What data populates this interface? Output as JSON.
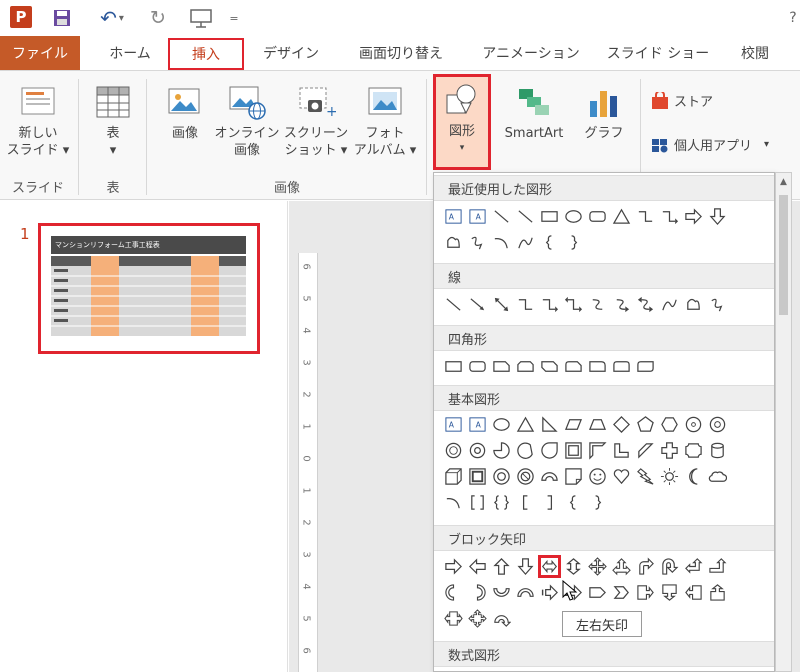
{
  "qat": {
    "app_logo": "P"
  },
  "tabs": [
    "ファイル",
    "ホーム",
    "挿入",
    "デザイン",
    "画面切り替え",
    "アニメーション",
    "スライド ショー",
    "校閲"
  ],
  "ribbon": {
    "new_slide": [
      "新しい",
      "スライド ▾"
    ],
    "table": [
      "表",
      "▾"
    ],
    "picture": "画像",
    "online_picture": [
      "オンライン",
      "画像"
    ],
    "screenshot": [
      "スクリーン",
      "ショット ▾"
    ],
    "photo_album": [
      "フォト",
      "アルバム ▾"
    ],
    "shapes": [
      "図形",
      "▾"
    ],
    "smartart": "SmartArt",
    "chart": "グラフ",
    "store": "ストア",
    "my_apps": "個人用アプリ",
    "my_apps_arrow": "▾",
    "groups": {
      "slides": "スライド",
      "table": "表",
      "images": "画像"
    }
  },
  "thumbnails": {
    "slide_number": "1",
    "slide_title": "マンションリフォーム工事工程表"
  },
  "ruler_marks": [
    "6",
    "5",
    "4",
    "3",
    "2",
    "1",
    "0",
    "1",
    "2",
    "3",
    "4",
    "5",
    "6"
  ],
  "dropdown": {
    "sections": [
      "最近使用した図形",
      "線",
      "四角形",
      "基本図形",
      "ブロック矢印",
      "数式図形"
    ],
    "tooltip": "左右矢印"
  }
}
